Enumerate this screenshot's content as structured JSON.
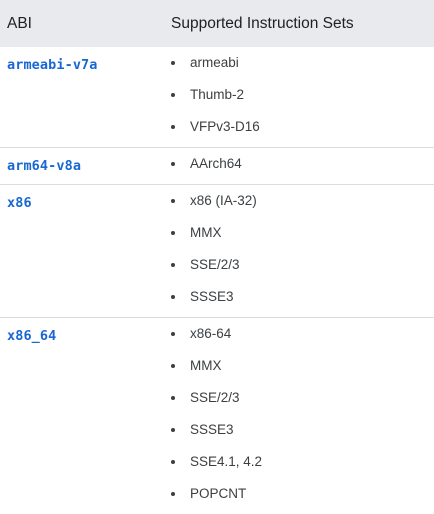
{
  "table": {
    "headers": {
      "abi": "ABI",
      "sets": "Supported Instruction Sets"
    },
    "rows": [
      {
        "abi": "armeabi-v7a",
        "sets": [
          "armeabi",
          "Thumb-2",
          "VFPv3-D16"
        ]
      },
      {
        "abi": "arm64-v8a",
        "sets": [
          "AArch64"
        ]
      },
      {
        "abi": "x86",
        "sets": [
          "x86 (IA-32)",
          "MMX",
          "SSE/2/3",
          "SSSE3"
        ]
      },
      {
        "abi": "x86_64",
        "sets": [
          "x86-64",
          "MMX",
          "SSE/2/3",
          "SSSE3",
          "SSE4.1, 4.2",
          "POPCNT"
        ]
      }
    ]
  },
  "colors": {
    "header_bg": "#e8eaed",
    "abi_text": "#1967d2",
    "divider": "#dadce0",
    "body_text": "#3c4043"
  }
}
